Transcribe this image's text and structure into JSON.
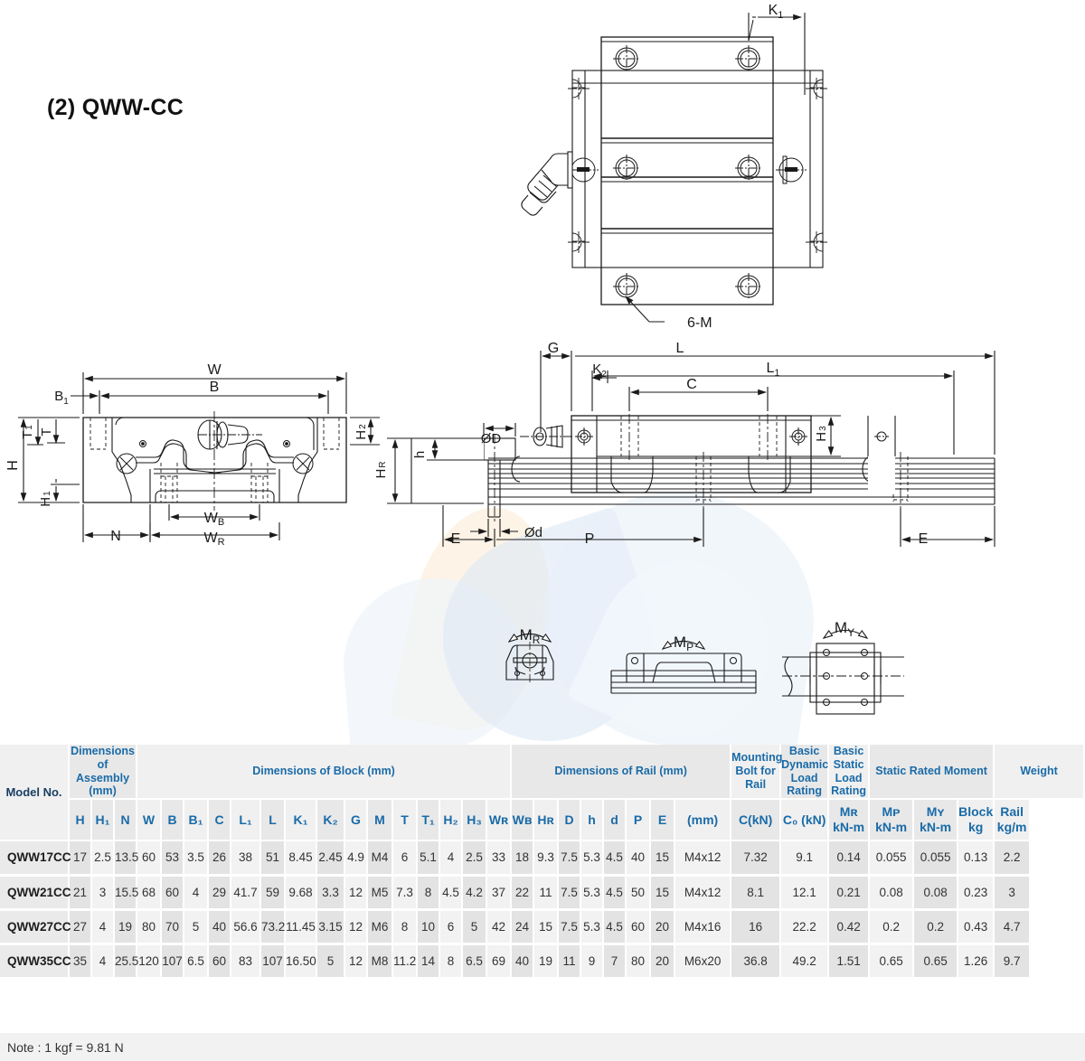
{
  "page": {
    "title": "(2) QWW-CC",
    "note": "Note : 1 kgf = 9.81 N"
  },
  "drawing_labels": {
    "top_view": [
      "K₁",
      "6-M"
    ],
    "front_view": [
      "W",
      "B",
      "B₁",
      "H",
      "H₁",
      "H₂",
      "T",
      "T₁",
      "N",
      "Wʙ",
      "Wʀ",
      "Hʀ"
    ],
    "side_view": [
      "G",
      "L",
      "L₁",
      "K₂",
      "C",
      "ØD",
      "Ød",
      "h",
      "E",
      "P",
      "H₃",
      "Hʀ"
    ],
    "moment_views": [
      "Mʀ",
      "Mᴘ",
      "Mʏ"
    ]
  },
  "table": {
    "group_headers": [
      {
        "label": "Model No.",
        "span": 1,
        "rowspan": 2
      },
      {
        "label": "Dimensions of Assembly (mm)",
        "span": 3
      },
      {
        "label": "Dimensions of Block (mm)",
        "span": 15
      },
      {
        "label": "Dimensions of Rail (mm)",
        "span": 8
      },
      {
        "label": "Mounting Bolt for Rail",
        "span": 1
      },
      {
        "label": "Basic Dynamic Load Rating",
        "span": 1
      },
      {
        "label": "Basic Static Load Rating",
        "span": 1
      },
      {
        "label": "Static Rated Moment",
        "span": 3
      },
      {
        "label": "Weight",
        "span": 2
      }
    ],
    "sub_headers": [
      "H",
      "H₁",
      "N",
      "W",
      "B",
      "B₁",
      "C",
      "L₁",
      "L",
      "K₁",
      "K₂",
      "G",
      "M",
      "T",
      "T₁",
      "H₂",
      "H₃",
      "Wʀ",
      "Wʙ",
      "Hʀ",
      "D",
      "h",
      "d",
      "P",
      "E",
      "(mm)",
      "C(kN)",
      "C₀ (kN)",
      "kN-m",
      "kN-m",
      "kN-m",
      "kg",
      "kg/m"
    ],
    "moment_symbols": [
      "Mʀ",
      "Mᴘ",
      "Mʏ"
    ],
    "weight_symbols": [
      "Block",
      "Rail"
    ],
    "rows": [
      {
        "model": "QWW17CC",
        "values": [
          "17",
          "2.5",
          "13.5",
          "60",
          "53",
          "3.5",
          "26",
          "38",
          "51",
          "8.45",
          "2.45",
          "4.9",
          "M4",
          "6",
          "5.1",
          "4",
          "2.5",
          "33",
          "18",
          "9.3",
          "7.5",
          "5.3",
          "4.5",
          "40",
          "15",
          "M4x12",
          "7.32",
          "9.1",
          "0.14",
          "0.055",
          "0.055",
          "0.13",
          "2.2"
        ]
      },
      {
        "model": "QWW21CC",
        "values": [
          "21",
          "3",
          "15.5",
          "68",
          "60",
          "4",
          "29",
          "41.7",
          "59",
          "9.68",
          "3.3",
          "12",
          "M5",
          "7.3",
          "8",
          "4.5",
          "4.2",
          "37",
          "22",
          "11",
          "7.5",
          "5.3",
          "4.5",
          "50",
          "15",
          "M4x12",
          "8.1",
          "12.1",
          "0.21",
          "0.08",
          "0.08",
          "0.23",
          "3"
        ]
      },
      {
        "model": "QWW27CC",
        "values": [
          "27",
          "4",
          "19",
          "80",
          "70",
          "5",
          "40",
          "56.6",
          "73.2",
          "11.45",
          "3.15",
          "12",
          "M6",
          "8",
          "10",
          "6",
          "5",
          "42",
          "24",
          "15",
          "7.5",
          "5.3",
          "4.5",
          "60",
          "20",
          "M4x16",
          "16",
          "22.2",
          "0.42",
          "0.2",
          "0.2",
          "0.43",
          "4.7"
        ]
      },
      {
        "model": "QWW35CC",
        "values": [
          "35",
          "4",
          "25.5",
          "120",
          "107",
          "6.5",
          "60",
          "83",
          "107",
          "16.50",
          "5",
          "12",
          "M8",
          "11.2",
          "14",
          "8",
          "6.5",
          "69",
          "40",
          "19",
          "11",
          "9",
          "7",
          "80",
          "20",
          "M6x20",
          "36.8",
          "49.2",
          "1.51",
          "0.65",
          "0.65",
          "1.26",
          "9.7"
        ]
      }
    ]
  },
  "colors": {
    "header_text": "#1a6ba8",
    "row_bg": "#f2f2f2",
    "row_bg_shade": "#e3e3e3",
    "line": "#1a1a1a"
  }
}
